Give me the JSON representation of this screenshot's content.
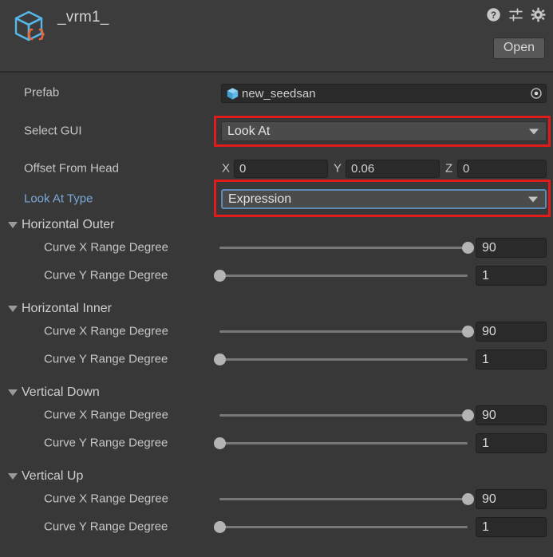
{
  "header": {
    "title": "_vrm1_",
    "asset_icon": "prefab-script-cube-icon",
    "open_label": "Open",
    "icons": [
      {
        "name": "help-icon",
        "label": "?"
      },
      {
        "name": "preset-sliders-icon",
        "label": "presets"
      },
      {
        "name": "gear-icon",
        "label": "settings"
      }
    ]
  },
  "fields": {
    "prefab": {
      "label": "Prefab",
      "value": "new_seedsan",
      "icon": "prefab-cube-icon",
      "picker_icon": "object-picker-icon"
    },
    "select_gui": {
      "label": "Select GUI",
      "value": "Look At",
      "highlighted": true
    },
    "offset_from_head": {
      "label": "Offset From Head",
      "x_axis": "X",
      "x": "0",
      "y_axis": "Y",
      "y": "0.06",
      "z_axis": "Z",
      "z": "0"
    },
    "look_at_type": {
      "label": "Look At Type",
      "value": "Expression",
      "highlighted": true,
      "focused": true
    }
  },
  "sections": [
    {
      "title": "Horizontal Outer",
      "rows": [
        {
          "label": "Curve X Range Degree",
          "value": "90",
          "fill": 1.0
        },
        {
          "label": "Curve Y Range Degree",
          "value": "1",
          "fill": 0.0
        }
      ]
    },
    {
      "title": "Horizontal Inner",
      "rows": [
        {
          "label": "Curve X Range Degree",
          "value": "90",
          "fill": 1.0
        },
        {
          "label": "Curve Y Range Degree",
          "value": "1",
          "fill": 0.0
        }
      ]
    },
    {
      "title": "Vertical Down",
      "rows": [
        {
          "label": "Curve X Range Degree",
          "value": "90",
          "fill": 1.0
        },
        {
          "label": "Curve Y Range Degree",
          "value": "1",
          "fill": 0.0
        }
      ]
    },
    {
      "title": "Vertical Up",
      "rows": [
        {
          "label": "Curve X Range Degree",
          "value": "90",
          "fill": 1.0
        },
        {
          "label": "Curve Y Range Degree",
          "value": "1",
          "fill": 0.0
        }
      ]
    }
  ],
  "colors": {
    "background": "#383838",
    "header_bg": "#3c3c3c",
    "annotation_red": "#e01b1b",
    "focus_blue": "#5c8bb8",
    "override_label_blue": "#7aa7d8",
    "cube_blue": "#56b8e8",
    "brace_orange": "#e8663c"
  }
}
